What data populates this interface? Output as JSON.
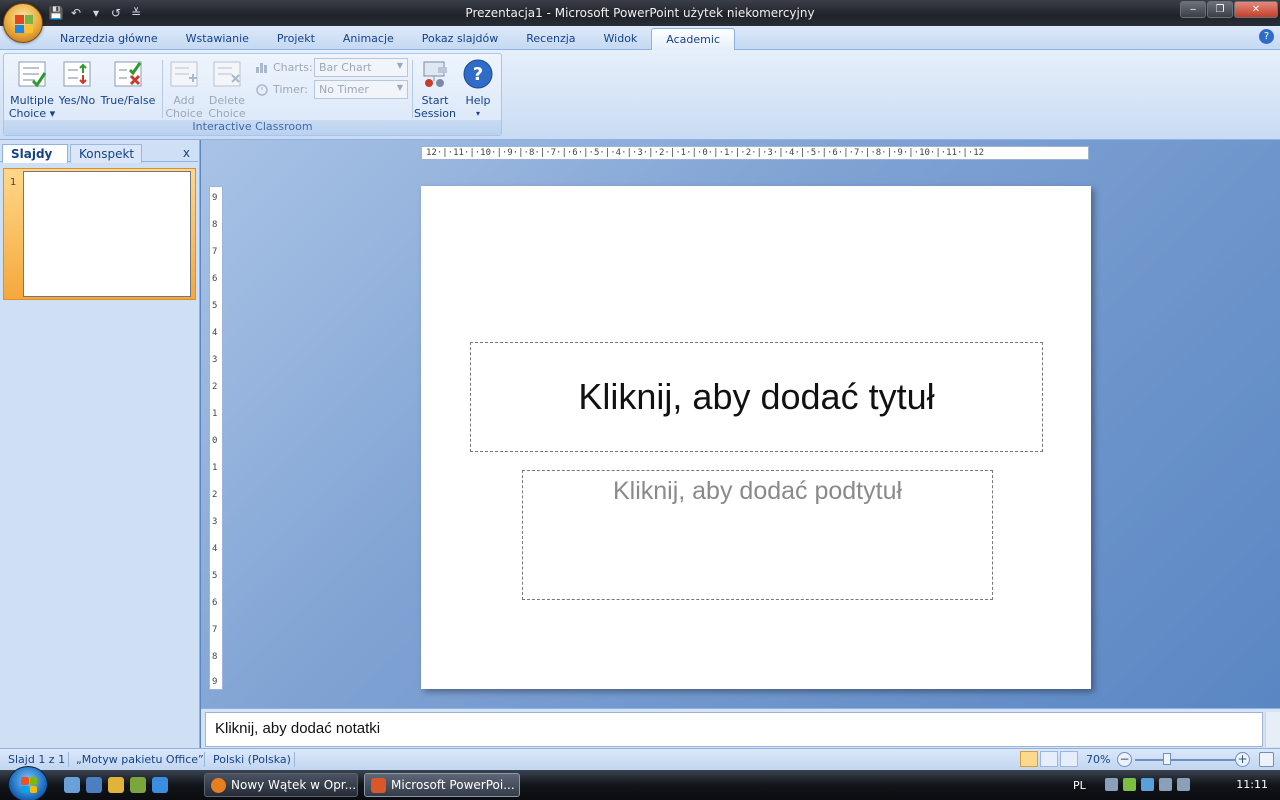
{
  "window": {
    "title": "Prezentacja1 - Microsoft PowerPoint użytek niekomercyjny",
    "controls": {
      "minimize": "‒",
      "maximize": "❐",
      "close": "✕"
    }
  },
  "qat": {
    "save": "💾",
    "undo": "↶",
    "undo_more": "▾",
    "redo": "↺",
    "customize": "≚"
  },
  "tabs": [
    {
      "label": "Narzędzia główne"
    },
    {
      "label": "Wstawianie"
    },
    {
      "label": "Projekt"
    },
    {
      "label": "Animacje"
    },
    {
      "label": "Pokaz slajdów"
    },
    {
      "label": "Recenzja"
    },
    {
      "label": "Widok"
    },
    {
      "label": "Academic"
    }
  ],
  "help_glyph": "?",
  "ribbon": {
    "group_label": "Interactive Classroom",
    "multiple_choice": {
      "line1": "Multiple",
      "line2": "Choice ▾"
    },
    "yes_no": {
      "line1": "Yes/No"
    },
    "true_false": {
      "line1": "True/False"
    },
    "add_choice": {
      "line1": "Add",
      "line2": "Choice"
    },
    "delete_choice": {
      "line1": "Delete",
      "line2": "Choice"
    },
    "charts_label": "Charts:",
    "charts_value": "Bar Chart",
    "timer_label": "Timer:",
    "timer_value": "No Timer",
    "start_session": {
      "line1": "Start",
      "line2": "Session"
    },
    "help": {
      "line1": "Help",
      "line2": "▾"
    }
  },
  "sidepane": {
    "tab_slides": "Slajdy",
    "tab_outline": "Konspekt",
    "close": "x",
    "slide_number": "1"
  },
  "ruler": {
    "horizontal": "12·|·11·|·10·|·9·|·8·|·7·|·6·|·5·|·4·|·3·|·2·|·1·|·0·|·1·|·2·|·3·|·4·|·5·|·6·|·7·|·8·|·9·|·10·|·11·|·12",
    "vertical": [
      "9",
      "8",
      "7",
      "6",
      "5",
      "4",
      "3",
      "2",
      "1",
      "0",
      "1",
      "2",
      "3",
      "4",
      "5",
      "6",
      "7",
      "8",
      "9"
    ]
  },
  "slide": {
    "title_placeholder": "Kliknij, aby dodać tytuł",
    "subtitle_placeholder": "Kliknij, aby dodać podtytuł"
  },
  "notes": {
    "placeholder": "Kliknij, aby dodać notatki"
  },
  "status": {
    "slide": "Slajd 1 z 1",
    "theme": "„Motyw pakietu Office”",
    "language": "Polski (Polska)",
    "zoom": "70%",
    "zoom_out": "−",
    "zoom_in": "+"
  },
  "taskbar": {
    "tasks": [
      {
        "label": "Nowy Wątek w Opr..."
      },
      {
        "label": "Microsoft PowerPoi..."
      }
    ],
    "lang": "PL",
    "clock": "11:11"
  },
  "colors": {
    "accent": "#15428b",
    "ribbon_bg": "#d2e2f6",
    "workspace": "#5a86c3"
  }
}
